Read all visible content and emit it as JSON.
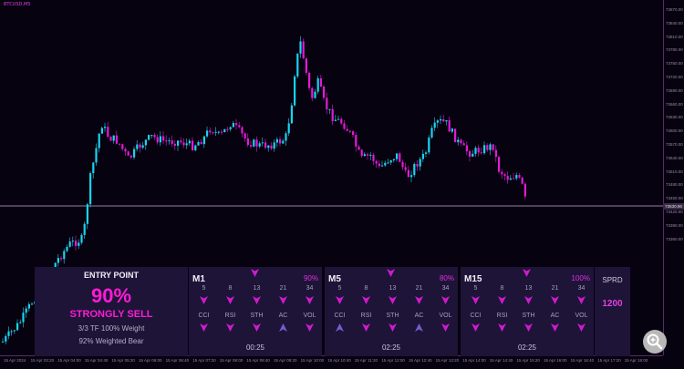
{
  "chart": {
    "symbol": "BTCUSD,M5",
    "current_price": "73630.96",
    "price_ticks": [
      "73870.00",
      "73840.00",
      "73810.00",
      "73780.00",
      "73750.00",
      "73720.00",
      "73690.00",
      "73660.00",
      "73630.00",
      "73600.00",
      "73570.00",
      "73540.00",
      "73510.00",
      "73480.00",
      "73450.00",
      "73420.00",
      "73390.00",
      "73360.00"
    ],
    "time_ticks": [
      "15 Apr 2024",
      "15 Apr 03:20",
      "15 Apr 04:00",
      "15 Apr 04:40",
      "15 Apr 05:20",
      "15 Apr 06:00",
      "15 Apr 06:40",
      "15 Apr 07:20",
      "15 Apr 08:00",
      "15 Apr 08:40",
      "15 Apr 09:20",
      "15 Apr 10:00",
      "15 Apr 10:40",
      "15 Apr 11:20",
      "15 Apr 12:00",
      "15 Apr 12:40",
      "15 Apr 13:20",
      "15 Apr 14:00",
      "15 Apr 14:40",
      "15 Apr 15:20",
      "15 Apr 16:00",
      "15 Apr 16:40",
      "15 Apr 17:20",
      "15 Apr 18:00"
    ],
    "colors": {
      "bull": "#19d3f0",
      "bear": "#e21ad6",
      "background": "#07020f",
      "price_line": "#c7a8d8"
    }
  },
  "entry": {
    "title": "ENTRY POINT",
    "percent": "90%",
    "signal": "STRONGLY SELL",
    "weight_line": "3/3 TF 100% Weight",
    "bear_line": "92% Weighted Bear"
  },
  "timeframes": [
    {
      "name": "M1",
      "percent": "90%",
      "periods": [
        "5",
        "8",
        "13",
        "21",
        "34"
      ],
      "indicators": [
        "CCI",
        "RSI",
        "STH",
        "AC",
        "VOL"
      ],
      "period_dirs": [
        "down",
        "down",
        "down",
        "down",
        "down"
      ],
      "indicator_dirs": [
        "down",
        "down",
        "down",
        "up",
        "down"
      ],
      "time": "00:25"
    },
    {
      "name": "M5",
      "percent": "80%",
      "periods": [
        "5",
        "8",
        "13",
        "21",
        "34"
      ],
      "indicators": [
        "CCI",
        "RSI",
        "STH",
        "AC",
        "VOL"
      ],
      "period_dirs": [
        "down",
        "down",
        "down",
        "down",
        "down"
      ],
      "indicator_dirs": [
        "up",
        "down",
        "down",
        "up",
        "down"
      ],
      "time": "02:25"
    },
    {
      "name": "M15",
      "percent": "100%",
      "periods": [
        "5",
        "8",
        "13",
        "21",
        "34"
      ],
      "indicators": [
        "CCI",
        "RSI",
        "STH",
        "AC",
        "VOL"
      ],
      "period_dirs": [
        "down",
        "down",
        "down",
        "down",
        "down"
      ],
      "indicator_dirs": [
        "down",
        "down",
        "down",
        "down",
        "down"
      ],
      "time": "02:25"
    }
  ],
  "spread": {
    "label": "SPRD",
    "value": "1200"
  }
}
